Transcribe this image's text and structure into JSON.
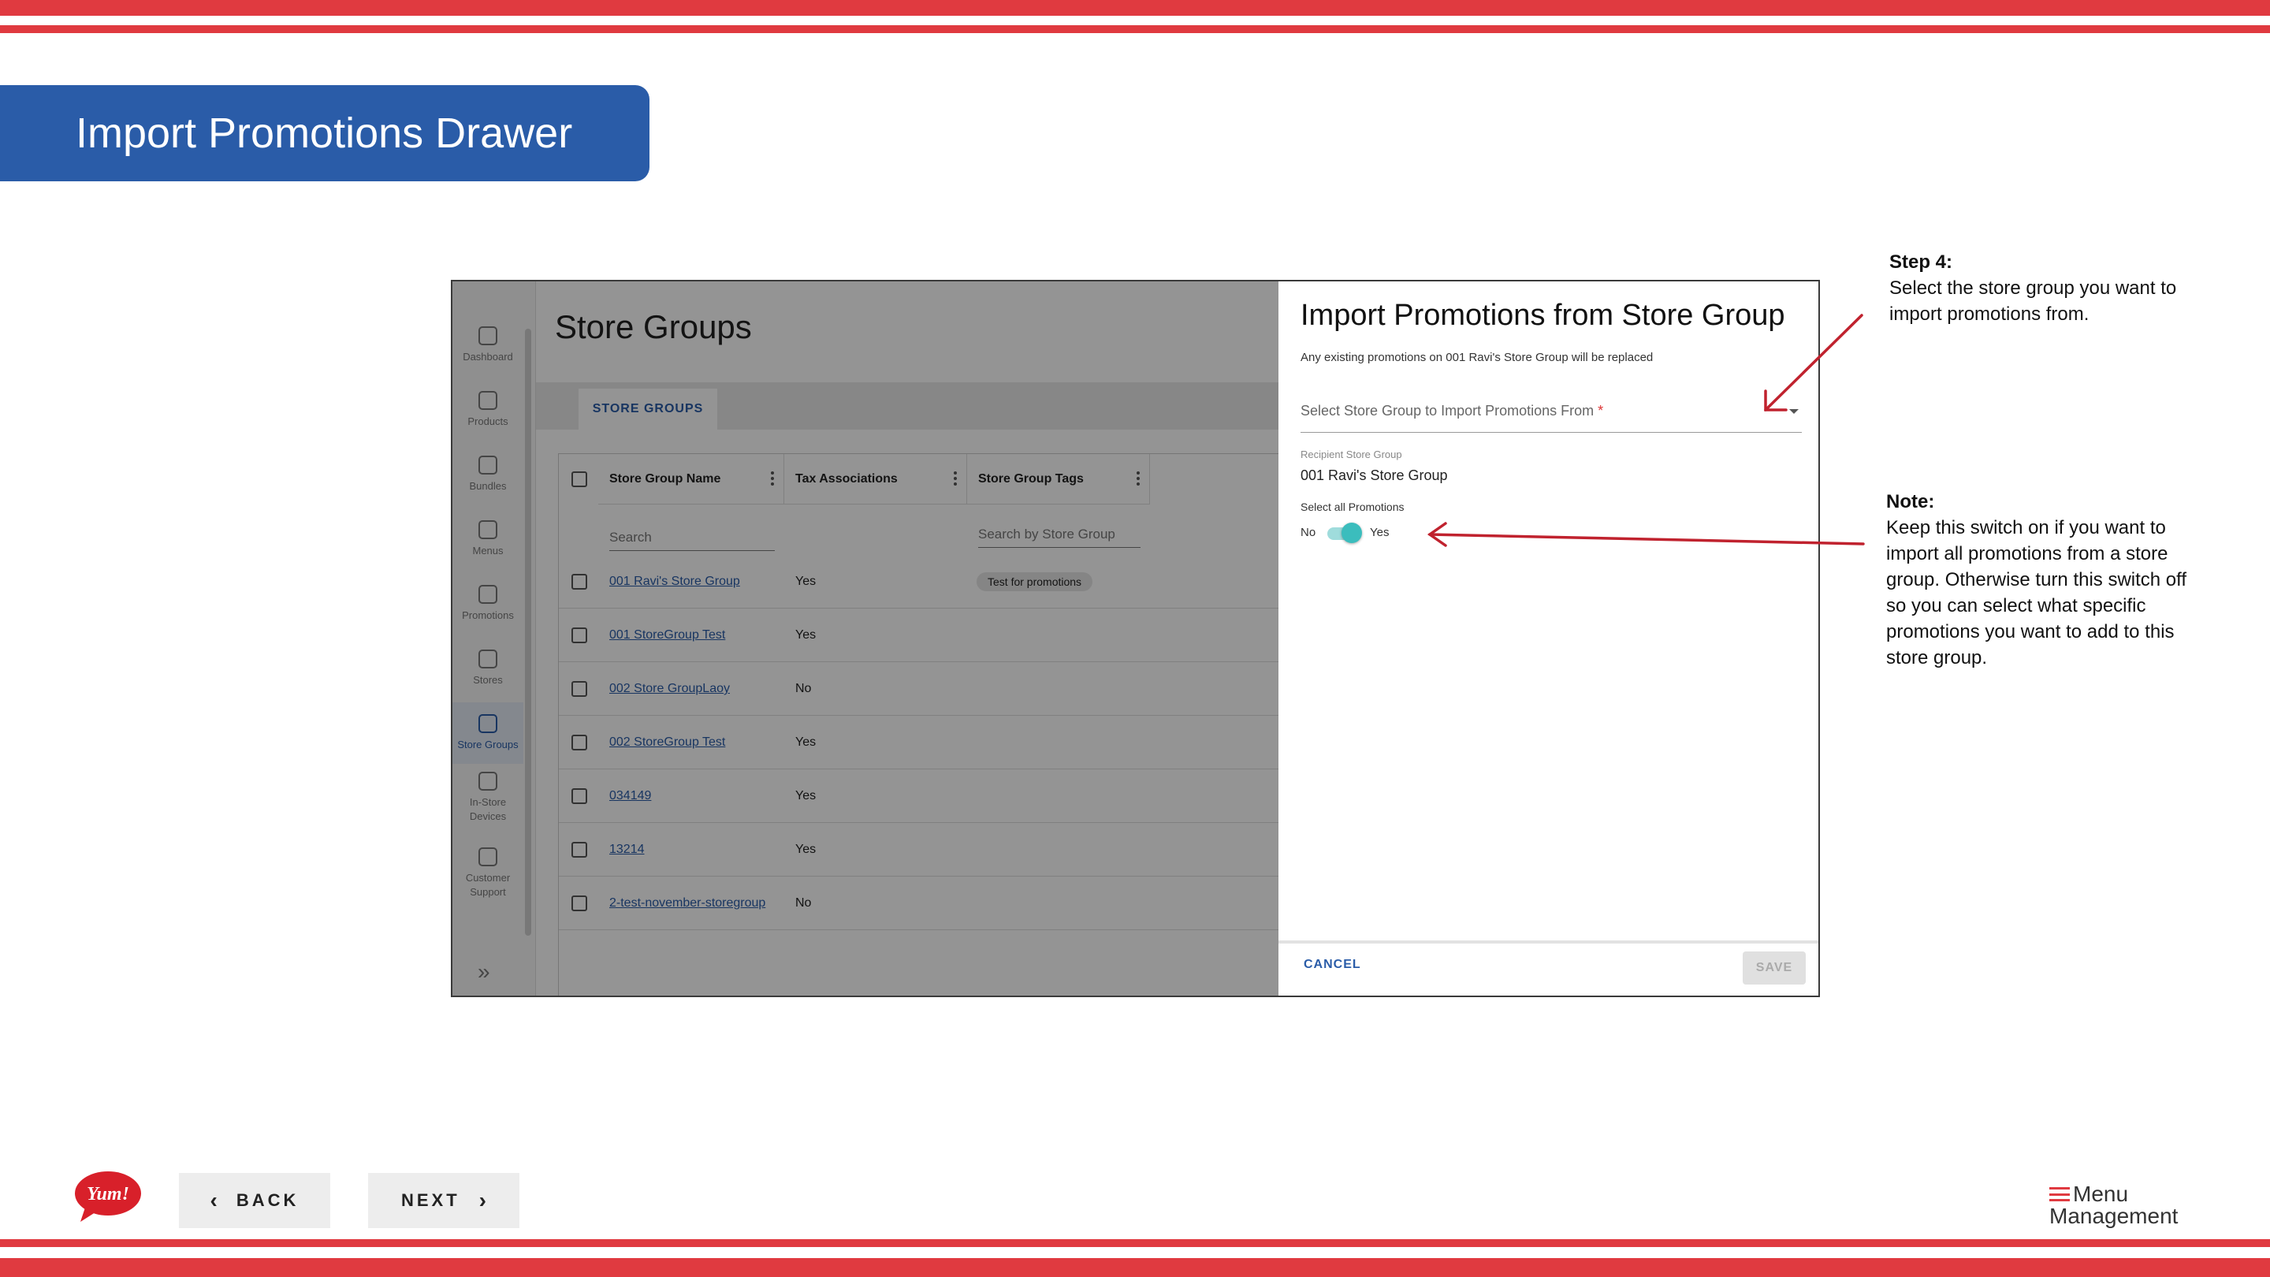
{
  "slide": {
    "title": "Import Promotions Drawer",
    "colors": {
      "stripe": "#e03a40",
      "banner": "#2a5ca8",
      "arrow": "#c0222e"
    }
  },
  "app": {
    "nav": [
      {
        "label": "Dashboard",
        "icon": "home-icon"
      },
      {
        "label": "Products",
        "icon": "calendar-icon"
      },
      {
        "label": "Bundles",
        "icon": "cube-icon"
      },
      {
        "label": "Menus",
        "icon": "document-icon"
      },
      {
        "label": "Promotions",
        "icon": "tag-icon"
      },
      {
        "label": "Stores",
        "icon": "storefront-icon"
      },
      {
        "label": "Store Groups",
        "icon": "grid-icon",
        "active": true
      },
      {
        "label": "In-Store Devices",
        "icon": "monitor-icon"
      },
      {
        "label": "Customer Support",
        "icon": "support-agent-icon"
      }
    ],
    "page_title": "Store Groups",
    "tab": "STORE GROUPS",
    "grid": {
      "columns": [
        "Store Group Name",
        "Tax Associations",
        "Store Group Tags"
      ],
      "filters": {
        "name_placeholder": "Search",
        "tags_placeholder": "Search by Store Group"
      },
      "rows": [
        {
          "name": "001 Ravi's Store Group",
          "tax": "Yes",
          "tag": "Test for promotions"
        },
        {
          "name": "001 StoreGroup Test",
          "tax": "Yes",
          "tag": ""
        },
        {
          "name": "002 Store GroupLaoy",
          "tax": "No",
          "tag": ""
        },
        {
          "name": "002 StoreGroup Test",
          "tax": "Yes",
          "tag": ""
        },
        {
          "name": "034149",
          "tax": "Yes",
          "tag": ""
        },
        {
          "name": "13214",
          "tax": "Yes",
          "tag": ""
        },
        {
          "name": "2-test-november-storegroup",
          "tax": "No",
          "tag": ""
        }
      ]
    }
  },
  "drawer": {
    "title": "Import Promotions from Store Group",
    "subtitle": "Any existing promotions on 001 Ravi's Store Group will be replaced",
    "select_label": "Select Store Group to Import Promotions From",
    "required_mark": "*",
    "recipient_label": "Recipient Store Group",
    "recipient_value": "001 Ravi's Store Group",
    "select_all_label": "Select all Promotions",
    "switch_off": "No",
    "switch_on": "Yes",
    "switch_state": true,
    "cancel": "CANCEL",
    "save": "SAVE"
  },
  "annotations": {
    "step4_title": "Step 4:",
    "step4_body": "Select the store group you want to import promotions from.",
    "note_title": "Note:",
    "note_body": "Keep this switch on if you want to import all promotions from a store group. Otherwise turn this switch off so you can select what specific promotions you want to add to this store group."
  },
  "footer": {
    "back": "BACK",
    "next": "NEXT",
    "brand_line1": "Menu",
    "brand_line2": "Management",
    "logo_text": "Yum!"
  }
}
